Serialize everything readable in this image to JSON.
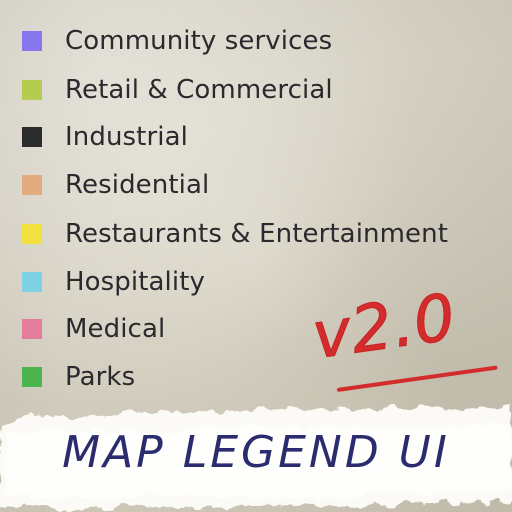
{
  "legend": {
    "items": [
      {
        "label": "Community services",
        "color": "#8877ee"
      },
      {
        "label": "Retail & Commercial",
        "color": "#b5cd4f"
      },
      {
        "label": "Industrial",
        "color": "#2b2b2b"
      },
      {
        "label": "Residential",
        "color": "#e2ac80"
      },
      {
        "label": "Restaurants & Entertainment",
        "color": "#f2e13e"
      },
      {
        "label": "Hospitality",
        "color": "#7fd2e5"
      },
      {
        "label": "Medical",
        "color": "#e57c9c"
      },
      {
        "label": "Parks",
        "color": "#4db54f"
      }
    ]
  },
  "badge": {
    "version": "v2.0",
    "color": "#d42c2c"
  },
  "banner": {
    "title": "MAP LEGEND UI",
    "color": "#2b2c6e"
  }
}
